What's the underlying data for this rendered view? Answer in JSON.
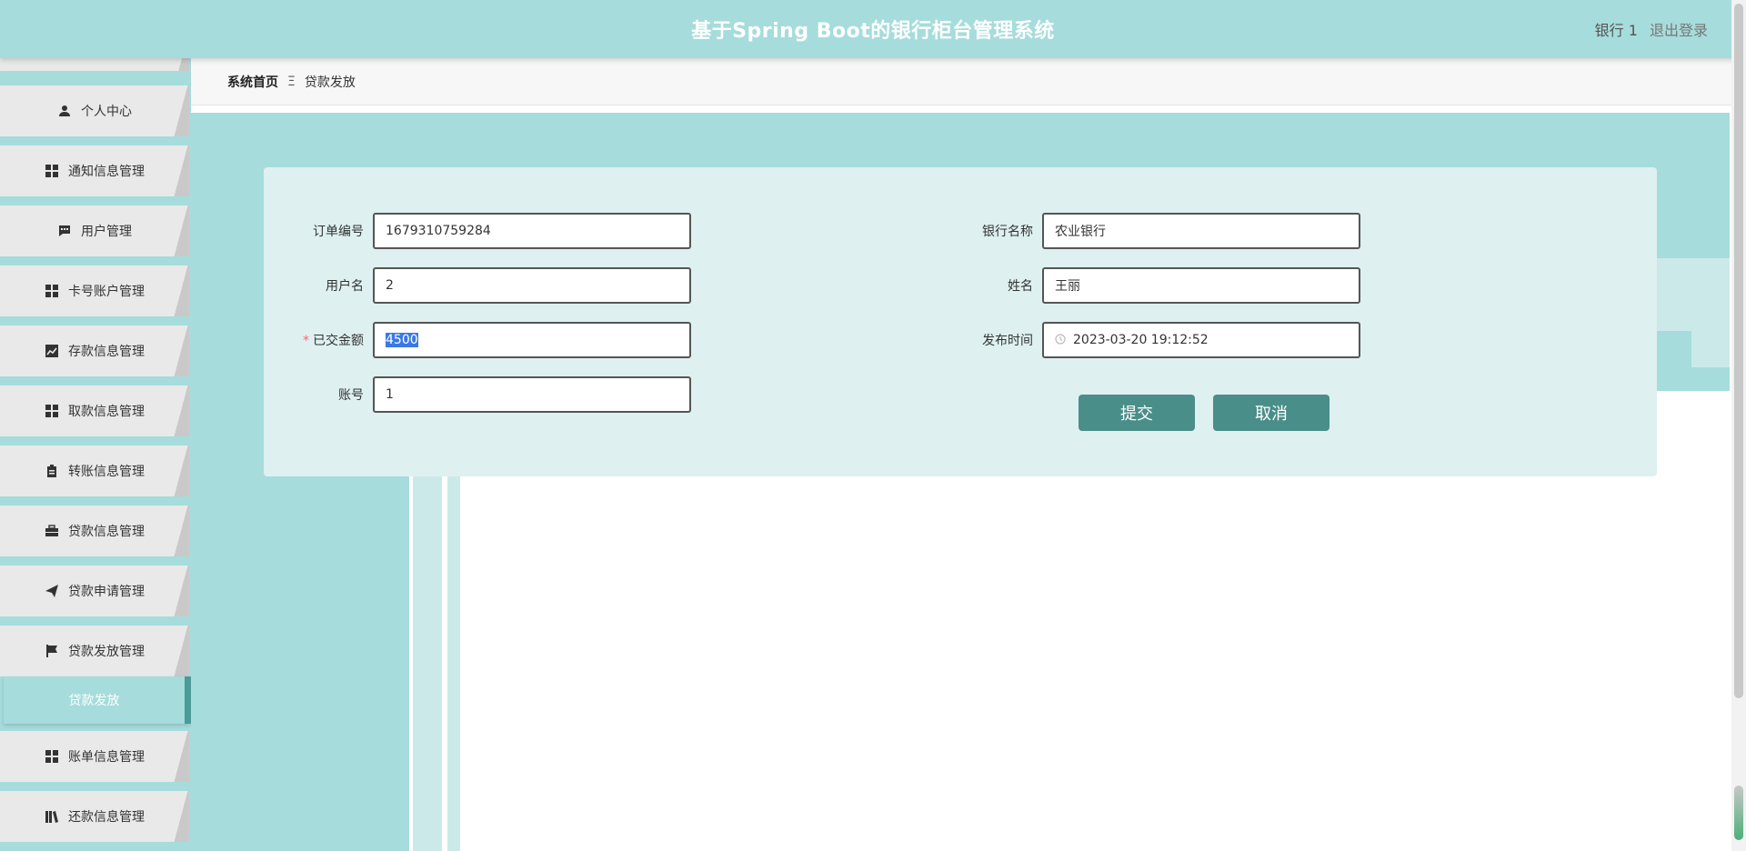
{
  "header": {
    "title": "基于Spring Boot的银行柜台管理系统",
    "user_name": "银行 1",
    "logout_label": "退出登录"
  },
  "sidebar": {
    "items": [
      {
        "label": "个人中心",
        "icon": "user-icon"
      },
      {
        "label": "通知信息管理",
        "icon": "grid-icon"
      },
      {
        "label": "用户管理",
        "icon": "chat-icon"
      },
      {
        "label": "卡号账户管理",
        "icon": "grid-icon"
      },
      {
        "label": "存款信息管理",
        "icon": "trend-chart-icon"
      },
      {
        "label": "取款信息管理",
        "icon": "grid-icon"
      },
      {
        "label": "转账信息管理",
        "icon": "clipboard-icon"
      },
      {
        "label": "贷款信息管理",
        "icon": "briefcase-icon"
      },
      {
        "label": "贷款申请管理",
        "icon": "send-icon"
      },
      {
        "label": "贷款发放管理",
        "icon": "flag-icon"
      },
      {
        "label": "贷款发放",
        "icon": "",
        "active": true
      },
      {
        "label": "账单信息管理",
        "icon": "grid-icon"
      },
      {
        "label": "还款信息管理",
        "icon": "library-icon"
      }
    ]
  },
  "breadcrumb": {
    "home": "系统首页",
    "separator": "Ξ",
    "current": "贷款发放"
  },
  "form": {
    "order_no_label": "订单编号",
    "order_no_value": "1679310759284",
    "username_label": "用户名",
    "username_value": "2",
    "paid_amount_label": "已交金额",
    "paid_amount_required": "*",
    "paid_amount_value": "4500",
    "account_label": "账号",
    "account_value": "1",
    "bank_name_label": "银行名称",
    "bank_name_value": "农业银行",
    "name_label": "姓名",
    "name_value": "王丽",
    "publish_time_label": "发布时间",
    "publish_time_value": "2023-03-20 19:12:52",
    "submit_label": "提交",
    "cancel_label": "取消"
  },
  "colors": {
    "primary": "#a6dcdc",
    "button": "#4a8e8a",
    "card": "#def0f0"
  }
}
